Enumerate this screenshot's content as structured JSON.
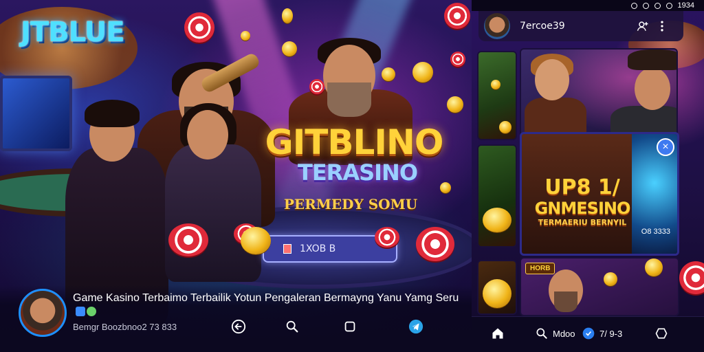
{
  "promo": {
    "logo": "JTBLUE",
    "title_main": "GITBLINO",
    "title_sub": "TERASINO",
    "title_tag": "PERMEDY SOMU",
    "input_value": "1XOB B"
  },
  "caption": {
    "title": "Game Kasino Terbaimo Terbailik Yotun Pengaleran Bermayng Yanu Yamg Seru",
    "meta": "Bemgr Boozbnoo2 73 833"
  },
  "left_toolbar": {
    "icons": [
      "back-arrow-icon",
      "search-icon",
      "square-icon",
      "telegram-icon"
    ]
  },
  "phone": {
    "status_bar": {
      "time": "1934"
    },
    "header": {
      "username": "7ercoe39"
    },
    "promo_card": {
      "title_line1": "UP8 1/",
      "title_line2": "GNMESINO",
      "title_line3": "TERMAERIU BERNYIL",
      "side_code": "O8 3333"
    },
    "mini_badge": "HORB",
    "nav": {
      "home_icon": "home-icon",
      "search_label": "Mdoo",
      "count_label": "7/ 9-3"
    }
  },
  "colors": {
    "accent_blue": "#1e90ff",
    "gold": "#ffd23a",
    "chip_red": "#e02a3a"
  }
}
